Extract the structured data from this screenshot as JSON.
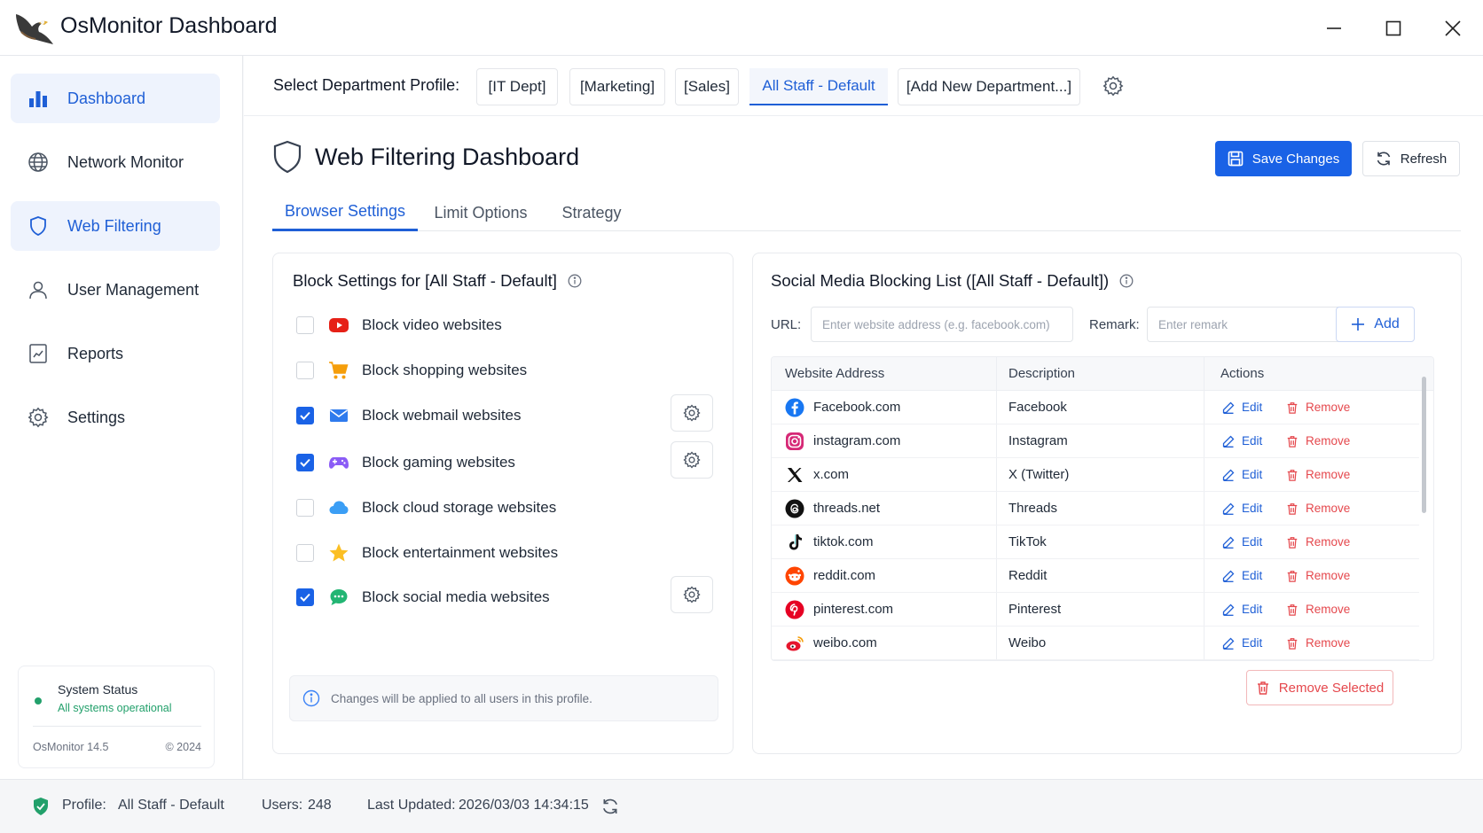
{
  "window": {
    "title": "OsMonitor Dashboard"
  },
  "sidebar": {
    "items": [
      {
        "label": "Dashboard",
        "icon": "bar-chart-icon",
        "active": true
      },
      {
        "label": "Network Monitor",
        "icon": "globe-icon",
        "active": false
      },
      {
        "label": "Web Filtering",
        "icon": "shield-icon",
        "active": true
      },
      {
        "label": "User Management",
        "icon": "user-icon",
        "active": false
      },
      {
        "label": "Reports",
        "icon": "report-icon",
        "active": false
      },
      {
        "label": "Settings",
        "icon": "gear-icon",
        "active": false
      }
    ],
    "status": {
      "title": "System Status",
      "subtitle": "All systems operational",
      "version": "OsMonitor 14.5",
      "copyright": "© 2024"
    }
  },
  "department": {
    "label": "Select Department Profile:",
    "tabs": [
      "[IT Dept]",
      "[Marketing]",
      "[Sales]",
      "All Staff - Default",
      "[Add New Department...]"
    ],
    "active_tab": "All Staff - Default"
  },
  "page": {
    "title": "Web Filtering Dashboard",
    "save_label": "Save Changes",
    "refresh_label": "Refresh",
    "tabs": [
      "Browser Settings",
      "Limit Options",
      "Strategy"
    ],
    "active_tab": "Browser Settings"
  },
  "block_settings": {
    "title": "Block Settings for [All Staff - Default]",
    "items": [
      {
        "label": "Block video websites",
        "checked": false,
        "icon": "youtube-icon",
        "has_settings": false
      },
      {
        "label": "Block shopping websites",
        "checked": false,
        "icon": "cart-icon",
        "has_settings": false
      },
      {
        "label": "Block webmail websites",
        "checked": true,
        "icon": "mail-icon",
        "has_settings": true
      },
      {
        "label": "Block gaming websites",
        "checked": true,
        "icon": "gamepad-icon",
        "has_settings": true
      },
      {
        "label": "Block cloud storage websites",
        "checked": false,
        "icon": "cloud-icon",
        "has_settings": false
      },
      {
        "label": "Block entertainment websites",
        "checked": false,
        "icon": "star-icon",
        "has_settings": false
      },
      {
        "label": "Block social media websites",
        "checked": true,
        "icon": "chat-icon",
        "has_settings": true
      }
    ],
    "note": "Changes will be applied to all users in this profile."
  },
  "social_list": {
    "title": "Social Media Blocking List ([All Staff - Default])",
    "url_label": "URL:",
    "url_placeholder": "Enter website address (e.g. facebook.com)",
    "remark_label": "Remark:",
    "remark_placeholder": "Enter remark",
    "add_label": "Add",
    "columns": [
      "Website Address",
      "Description",
      "Actions"
    ],
    "edit_label": "Edit",
    "remove_label": "Remove",
    "rows": [
      {
        "site": "Facebook.com",
        "desc": "Facebook",
        "icon": "facebook-icon",
        "color": "#1877f2"
      },
      {
        "site": "instagram.com",
        "desc": "Instagram",
        "icon": "instagram-icon",
        "color": "#d62976"
      },
      {
        "site": "x.com",
        "desc": "X (Twitter)",
        "icon": "x-icon",
        "color": "#111111"
      },
      {
        "site": "threads.net",
        "desc": "Threads",
        "icon": "threads-icon",
        "color": "#111111"
      },
      {
        "site": "tiktok.com",
        "desc": "TikTok",
        "icon": "tiktok-icon",
        "color": "#111111"
      },
      {
        "site": "reddit.com",
        "desc": "Reddit",
        "icon": "reddit-icon",
        "color": "#ff4500"
      },
      {
        "site": "pinterest.com",
        "desc": "Pinterest",
        "icon": "pinterest-icon",
        "color": "#e60023"
      },
      {
        "site": "weibo.com",
        "desc": "Weibo",
        "icon": "weibo-icon",
        "color": "#e6162d"
      }
    ],
    "remove_selected_label": "Remove Selected"
  },
  "footer": {
    "profile_label": "Profile:",
    "profile_value": "All Staff - Default",
    "users_label": "Users:",
    "users_value": "248",
    "updated_label": "Last Updated:",
    "updated_value": "2026/03/03 14:34:15"
  },
  "colors": {
    "accent": "#1a62e6",
    "danger": "#e5484d",
    "success": "#22a06b"
  }
}
